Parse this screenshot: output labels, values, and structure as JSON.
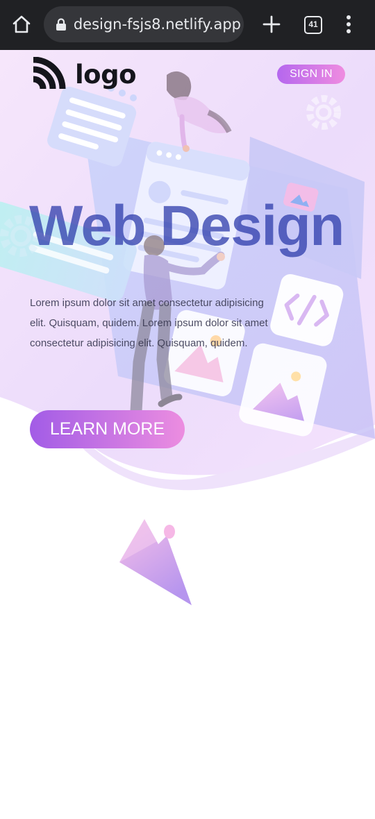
{
  "browser": {
    "url": "design-fsjs8.netlify.app",
    "tab_count": "41",
    "icons": [
      "home-icon",
      "lock-icon",
      "plus-icon",
      "tab-switcher-icon",
      "more-menu-icon"
    ]
  },
  "header": {
    "logo_text": "logo",
    "sign_in_label": "SIGN IN"
  },
  "hero": {
    "title": "Web Design",
    "description": "Lorem ipsum dolor sit amet consectetur adipisicing elit. Quisquam, quidem. Lorem ipsum dolor sit amet consectetur adipisicing elit. Quisquam, quidem.",
    "cta_label": "LEARN MORE"
  },
  "colors": {
    "accent_purple": "#a25ce6",
    "accent_pink": "#ec8de0",
    "title_blue": "#2b3aaa",
    "chrome_dark": "#202124"
  }
}
